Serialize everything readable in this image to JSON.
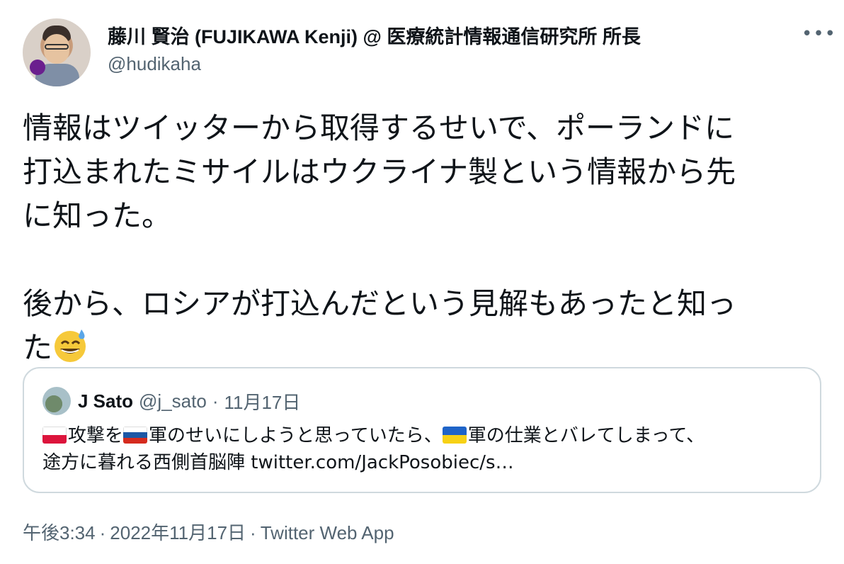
{
  "author": {
    "display_name": "藤川 賢治 (FUJIKAWA Kenji) @ 医療統計情報通信研究所 所長",
    "handle": "@hudikaha"
  },
  "more_icon": "more-horizontal-icon",
  "tweet": {
    "line1": "情報はツイッターから取得するせいで、ポーランドに",
    "line2": "打込まれたミサイルはウクライナ製という情報から先",
    "line3": "に知った。",
    "line4": "後から、ロシアが打込んだという見解もあったと知っ",
    "line5": "た",
    "emoji": "grinning-face-with-sweat-emoji"
  },
  "quote": {
    "name": "J Sato",
    "handle": "@j_sato",
    "separator": "·",
    "date": "11月17日",
    "text_part1": "攻撃を",
    "text_part2": "軍のせいにしようと思っていたら、",
    "text_part3": "軍の仕業とバレてしまって、",
    "text_line2": "途方に暮れる西側首脳陣 twitter.com/JackPosobiec/s…",
    "flags": [
      "poland-flag",
      "russia-flag",
      "ukraine-flag"
    ]
  },
  "meta": {
    "time": "午後3:34",
    "separator": "·",
    "date": "2022年11月17日",
    "source": "Twitter Web App"
  },
  "colors": {
    "text": "#0f1419",
    "secondary": "#536471",
    "border": "#cfd9de"
  }
}
